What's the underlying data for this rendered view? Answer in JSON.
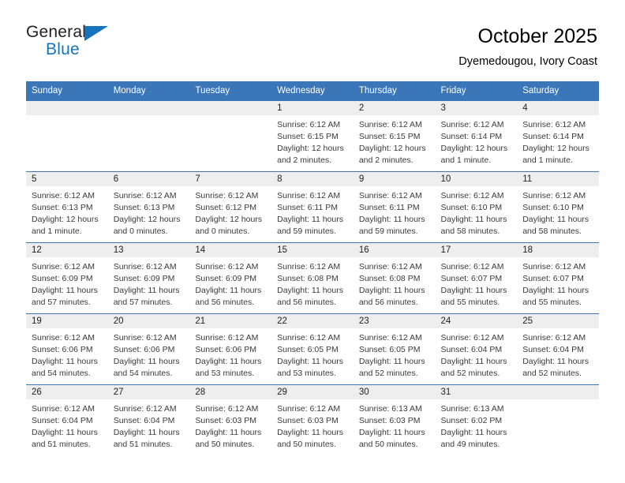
{
  "logo": {
    "word1": "General",
    "word2": "Blue",
    "accent_color": "#1574bb"
  },
  "header": {
    "title": "October 2025",
    "subtitle": "Dyemedougou, Ivory Coast",
    "header_bg": "#3a76b8",
    "daynum_bg": "#eeeeee"
  },
  "weekdays": [
    "Sunday",
    "Monday",
    "Tuesday",
    "Wednesday",
    "Thursday",
    "Friday",
    "Saturday"
  ],
  "weeks": [
    [
      {
        "day": "",
        "empty": true
      },
      {
        "day": "",
        "empty": true
      },
      {
        "day": "",
        "empty": true
      },
      {
        "day": "1",
        "sunrise": "Sunrise: 6:12 AM",
        "sunset": "Sunset: 6:15 PM",
        "daylight": "Daylight: 12 hours and 2 minutes."
      },
      {
        "day": "2",
        "sunrise": "Sunrise: 6:12 AM",
        "sunset": "Sunset: 6:15 PM",
        "daylight": "Daylight: 12 hours and 2 minutes."
      },
      {
        "day": "3",
        "sunrise": "Sunrise: 6:12 AM",
        "sunset": "Sunset: 6:14 PM",
        "daylight": "Daylight: 12 hours and 1 minute."
      },
      {
        "day": "4",
        "sunrise": "Sunrise: 6:12 AM",
        "sunset": "Sunset: 6:14 PM",
        "daylight": "Daylight: 12 hours and 1 minute."
      }
    ],
    [
      {
        "day": "5",
        "sunrise": "Sunrise: 6:12 AM",
        "sunset": "Sunset: 6:13 PM",
        "daylight": "Daylight: 12 hours and 1 minute."
      },
      {
        "day": "6",
        "sunrise": "Sunrise: 6:12 AM",
        "sunset": "Sunset: 6:13 PM",
        "daylight": "Daylight: 12 hours and 0 minutes."
      },
      {
        "day": "7",
        "sunrise": "Sunrise: 6:12 AM",
        "sunset": "Sunset: 6:12 PM",
        "daylight": "Daylight: 12 hours and 0 minutes."
      },
      {
        "day": "8",
        "sunrise": "Sunrise: 6:12 AM",
        "sunset": "Sunset: 6:11 PM",
        "daylight": "Daylight: 11 hours and 59 minutes."
      },
      {
        "day": "9",
        "sunrise": "Sunrise: 6:12 AM",
        "sunset": "Sunset: 6:11 PM",
        "daylight": "Daylight: 11 hours and 59 minutes."
      },
      {
        "day": "10",
        "sunrise": "Sunrise: 6:12 AM",
        "sunset": "Sunset: 6:10 PM",
        "daylight": "Daylight: 11 hours and 58 minutes."
      },
      {
        "day": "11",
        "sunrise": "Sunrise: 6:12 AM",
        "sunset": "Sunset: 6:10 PM",
        "daylight": "Daylight: 11 hours and 58 minutes."
      }
    ],
    [
      {
        "day": "12",
        "sunrise": "Sunrise: 6:12 AM",
        "sunset": "Sunset: 6:09 PM",
        "daylight": "Daylight: 11 hours and 57 minutes."
      },
      {
        "day": "13",
        "sunrise": "Sunrise: 6:12 AM",
        "sunset": "Sunset: 6:09 PM",
        "daylight": "Daylight: 11 hours and 57 minutes."
      },
      {
        "day": "14",
        "sunrise": "Sunrise: 6:12 AM",
        "sunset": "Sunset: 6:09 PM",
        "daylight": "Daylight: 11 hours and 56 minutes."
      },
      {
        "day": "15",
        "sunrise": "Sunrise: 6:12 AM",
        "sunset": "Sunset: 6:08 PM",
        "daylight": "Daylight: 11 hours and 56 minutes."
      },
      {
        "day": "16",
        "sunrise": "Sunrise: 6:12 AM",
        "sunset": "Sunset: 6:08 PM",
        "daylight": "Daylight: 11 hours and 56 minutes."
      },
      {
        "day": "17",
        "sunrise": "Sunrise: 6:12 AM",
        "sunset": "Sunset: 6:07 PM",
        "daylight": "Daylight: 11 hours and 55 minutes."
      },
      {
        "day": "18",
        "sunrise": "Sunrise: 6:12 AM",
        "sunset": "Sunset: 6:07 PM",
        "daylight": "Daylight: 11 hours and 55 minutes."
      }
    ],
    [
      {
        "day": "19",
        "sunrise": "Sunrise: 6:12 AM",
        "sunset": "Sunset: 6:06 PM",
        "daylight": "Daylight: 11 hours and 54 minutes."
      },
      {
        "day": "20",
        "sunrise": "Sunrise: 6:12 AM",
        "sunset": "Sunset: 6:06 PM",
        "daylight": "Daylight: 11 hours and 54 minutes."
      },
      {
        "day": "21",
        "sunrise": "Sunrise: 6:12 AM",
        "sunset": "Sunset: 6:06 PM",
        "daylight": "Daylight: 11 hours and 53 minutes."
      },
      {
        "day": "22",
        "sunrise": "Sunrise: 6:12 AM",
        "sunset": "Sunset: 6:05 PM",
        "daylight": "Daylight: 11 hours and 53 minutes."
      },
      {
        "day": "23",
        "sunrise": "Sunrise: 6:12 AM",
        "sunset": "Sunset: 6:05 PM",
        "daylight": "Daylight: 11 hours and 52 minutes."
      },
      {
        "day": "24",
        "sunrise": "Sunrise: 6:12 AM",
        "sunset": "Sunset: 6:04 PM",
        "daylight": "Daylight: 11 hours and 52 minutes."
      },
      {
        "day": "25",
        "sunrise": "Sunrise: 6:12 AM",
        "sunset": "Sunset: 6:04 PM",
        "daylight": "Daylight: 11 hours and 52 minutes."
      }
    ],
    [
      {
        "day": "26",
        "sunrise": "Sunrise: 6:12 AM",
        "sunset": "Sunset: 6:04 PM",
        "daylight": "Daylight: 11 hours and 51 minutes."
      },
      {
        "day": "27",
        "sunrise": "Sunrise: 6:12 AM",
        "sunset": "Sunset: 6:04 PM",
        "daylight": "Daylight: 11 hours and 51 minutes."
      },
      {
        "day": "28",
        "sunrise": "Sunrise: 6:12 AM",
        "sunset": "Sunset: 6:03 PM",
        "daylight": "Daylight: 11 hours and 50 minutes."
      },
      {
        "day": "29",
        "sunrise": "Sunrise: 6:12 AM",
        "sunset": "Sunset: 6:03 PM",
        "daylight": "Daylight: 11 hours and 50 minutes."
      },
      {
        "day": "30",
        "sunrise": "Sunrise: 6:13 AM",
        "sunset": "Sunset: 6:03 PM",
        "daylight": "Daylight: 11 hours and 50 minutes."
      },
      {
        "day": "31",
        "sunrise": "Sunrise: 6:13 AM",
        "sunset": "Sunset: 6:02 PM",
        "daylight": "Daylight: 11 hours and 49 minutes."
      },
      {
        "day": "",
        "empty": true
      }
    ]
  ]
}
